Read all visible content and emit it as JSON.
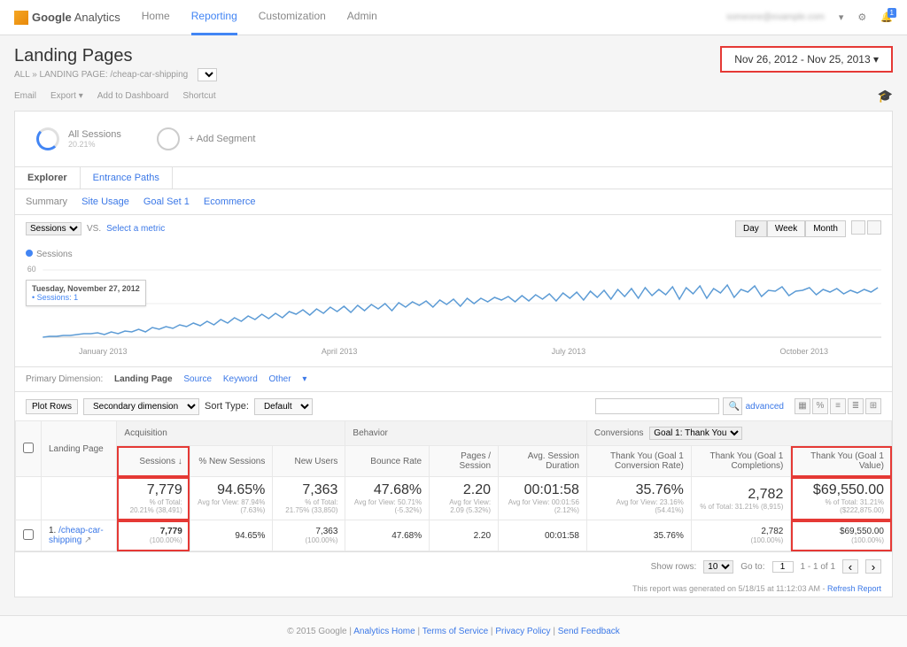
{
  "brand": {
    "name": "Google",
    "product": "Analytics"
  },
  "topnav": {
    "home": "Home",
    "reporting": "Reporting",
    "customization": "Customization",
    "admin": "Admin"
  },
  "account_blur": "someone@example.com",
  "bell_count": "1",
  "page_title": "Landing Pages",
  "crumb_all": "ALL",
  "crumb_sep": "»",
  "crumb_label": "LANDING PAGE:",
  "crumb_value": "/cheap-car-shipping",
  "date_range": "Nov 26, 2012 - Nov 25, 2013",
  "toolbar": {
    "email": "Email",
    "export": "Export",
    "add": "Add to Dashboard",
    "shortcut": "Shortcut"
  },
  "segments": {
    "all": "All Sessions",
    "all_pct": "20.21%",
    "add": "+ Add Segment"
  },
  "tabs": {
    "explorer": "Explorer",
    "entrance": "Entrance Paths"
  },
  "subtabs": {
    "summary": "Summary",
    "site": "Site Usage",
    "goal": "Goal Set 1",
    "ecom": "Ecommerce"
  },
  "metric_select": "Sessions",
  "vs": "VS.",
  "select_metric": "Select a metric",
  "granularity": {
    "day": "Day",
    "week": "Week",
    "month": "Month"
  },
  "legend": "Sessions",
  "chart_tip": {
    "date": "Tuesday, November 27, 2012",
    "metric": "• Sessions: 1"
  },
  "y_axis": {
    "t": "60",
    "m": "30"
  },
  "x_axis": {
    "jan": "January 2013",
    "apr": "April 2013",
    "jul": "July 2013",
    "oct": "October 2013"
  },
  "prim_dim_label": "Primary Dimension:",
  "prim_dim": {
    "landing": "Landing Page",
    "source": "Source",
    "keyword": "Keyword",
    "other": "Other"
  },
  "plot_rows": "Plot Rows",
  "sec_dim": "Secondary dimension",
  "sort_type": "Sort Type:",
  "sort_default": "Default",
  "advanced": "advanced",
  "headers": {
    "landing": "Landing Page",
    "acq": "Acquisition",
    "beh": "Behavior",
    "conv": "Conversions",
    "conv_goal": "Goal 1: Thank You",
    "sessions": "Sessions",
    "new_sess": "% New Sessions",
    "new_users": "New Users",
    "bounce": "Bounce Rate",
    "pages": "Pages / Session",
    "avg_dur": "Avg. Session Duration",
    "cr": "Thank You (Goal 1 Conversion Rate)",
    "compl": "Thank You (Goal 1 Completions)",
    "value": "Thank You (Goal 1 Value)"
  },
  "totals": {
    "sessions": {
      "v": "7,779",
      "s": "% of Total: 20.21% (38,491)"
    },
    "new_sess": {
      "v": "94.65%",
      "s": "Avg for View: 87.94% (7.63%)"
    },
    "new_users": {
      "v": "7,363",
      "s": "% of Total: 21.75% (33,850)"
    },
    "bounce": {
      "v": "47.68%",
      "s": "Avg for View: 50.71% (-5.32%)"
    },
    "pages": {
      "v": "2.20",
      "s": "Avg for View: 2.09 (5.32%)"
    },
    "dur": {
      "v": "00:01:58",
      "s": "Avg for View: 00:01:56 (2.12%)"
    },
    "cr": {
      "v": "35.76%",
      "s": "Avg for View: 23.16% (54.41%)"
    },
    "compl": {
      "v": "2,782",
      "s": "% of Total: 31.21% (8,915)"
    },
    "value": {
      "v": "$69,550.00",
      "s": "% of Total: 31.21% ($222,875.00)"
    }
  },
  "row": {
    "n": "1.",
    "page": "/cheap-car-shipping",
    "sessions": "7,779",
    "sessions_pct": "(100.00%)",
    "new_sess": "94.65%",
    "new_users": "7,363",
    "new_users_pct": "(100.00%)",
    "bounce": "47.68%",
    "pages": "2.20",
    "dur": "00:01:58",
    "cr": "35.76%",
    "compl": "2,782",
    "compl_pct": "(100.00%)",
    "value": "$69,550.00",
    "value_pct": "(100.00%)"
  },
  "pager": {
    "show": "Show rows:",
    "rows": "10",
    "goto": "Go to:",
    "page": "1",
    "range": "1 - 1 of 1"
  },
  "report_note": "This report was generated on 5/18/15 at 11:12:03 AM -",
  "refresh": "Refresh Report",
  "footer": {
    "copy": "© 2015 Google",
    "home": "Analytics Home",
    "tos": "Terms of Service",
    "priv": "Privacy Policy",
    "fb": "Send Feedback"
  },
  "chart_data": {
    "type": "line",
    "xlabel": "",
    "ylabel": "",
    "ylim": [
      0,
      60
    ],
    "x_ticks": [
      "January 2013",
      "April 2013",
      "July 2013",
      "October 2013"
    ],
    "series": [
      {
        "name": "Sessions",
        "values": [
          1,
          2,
          2,
          3,
          3,
          4,
          4,
          5,
          5,
          4,
          6,
          5,
          7,
          6,
          8,
          6,
          9,
          8,
          10,
          9,
          12,
          11,
          14,
          12,
          15,
          13,
          16,
          14,
          18,
          15,
          19,
          16,
          20,
          17,
          21,
          18,
          22,
          20,
          23,
          19,
          24,
          21,
          25,
          22,
          26,
          21,
          27,
          22,
          28,
          23,
          29,
          22,
          30,
          24,
          31,
          25,
          32,
          26,
          33,
          25,
          34,
          27,
          35,
          26,
          36,
          28,
          36,
          29,
          37,
          30,
          38,
          29,
          39,
          30,
          40,
          31,
          41,
          30,
          42,
          32,
          43,
          31,
          44,
          33,
          45,
          32,
          46,
          34,
          47,
          33,
          48,
          35,
          49,
          36,
          50,
          34,
          51,
          37,
          50,
          38,
          52,
          36,
          51,
          39,
          53,
          37,
          52,
          40,
          54,
          38,
          53,
          41,
          55,
          39,
          54,
          42,
          56,
          40,
          55,
          43,
          57,
          41,
          56,
          42,
          58,
          43,
          56,
          44,
          57,
          42,
          55,
          45,
          58,
          44,
          56,
          43,
          57,
          46,
          55,
          44,
          58,
          47,
          56,
          45,
          57,
          43,
          55,
          46,
          58,
          44,
          56,
          47,
          54,
          45,
          57,
          48,
          55,
          46,
          53,
          44,
          56,
          47,
          54,
          45,
          52,
          43,
          55,
          46,
          53,
          44,
          51,
          42,
          54,
          45,
          52,
          43,
          50,
          41,
          53,
          44,
          51,
          42,
          49,
          40,
          52,
          43,
          50,
          41,
          48,
          39,
          51,
          42,
          49,
          40
        ]
      }
    ]
  }
}
